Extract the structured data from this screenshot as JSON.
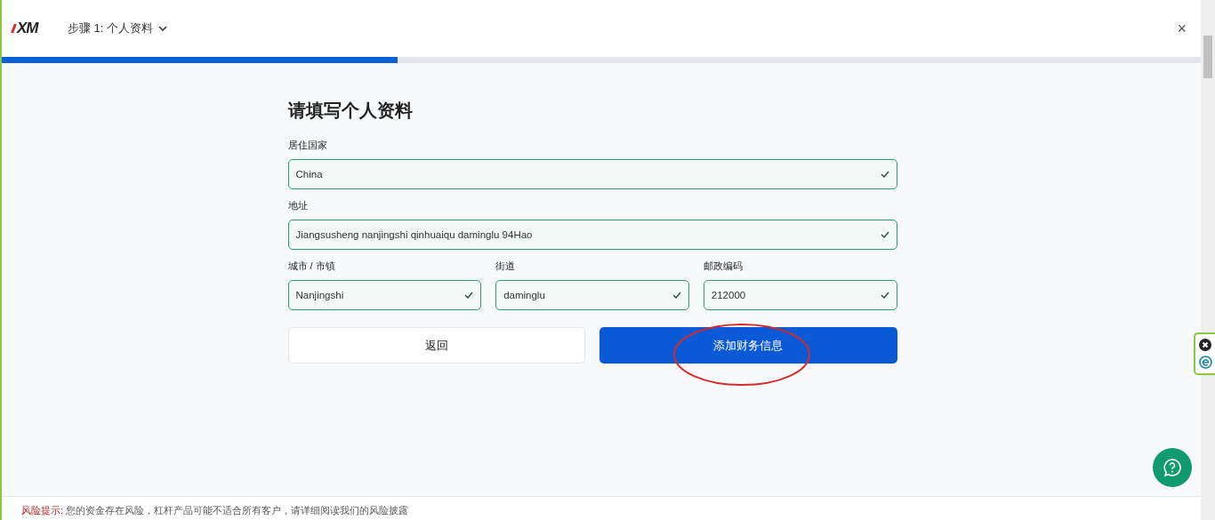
{
  "header": {
    "logo": "XM",
    "step": "步骤 1: 个人资料",
    "close": "×"
  },
  "progress": {
    "level": 0.33
  },
  "form": {
    "title": "请填写个人资料",
    "fields": [
      {
        "label": "居住国家",
        "value": "China",
        "valid": true,
        "kind": "wide"
      },
      {
        "label": "地址",
        "value": "Jiangsusheng nanjingshi qinhuaiqu daminglu 94Hao",
        "valid": true,
        "kind": "wide"
      },
      {
        "label": "城市 / 市镇",
        "value": "Nanjingshi",
        "valid": true,
        "kind": "column"
      },
      {
        "label": "街道",
        "value": "daminglu",
        "valid": true,
        "kind": "column"
      },
      {
        "label": "邮政编码",
        "value": "212000",
        "valid": true,
        "kind": "column"
      }
    ],
    "buttons": [
      {
        "label": "返回",
        "kind": "secondary"
      },
      {
        "label": "添加财务信息",
        "kind": "primary"
      }
    ]
  },
  "footer": {
    "warning": "风险提示:",
    "text": "您的资金存在风险，杠杆产品可能不适合所有客户，请详细阅读我们的风险披露"
  }
}
